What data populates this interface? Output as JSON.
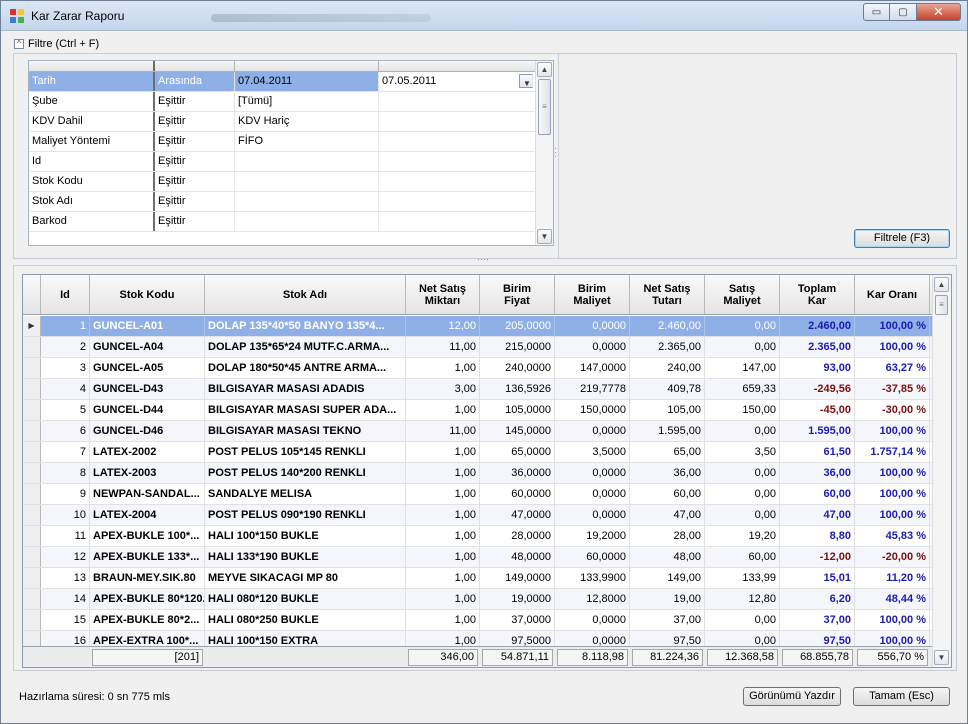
{
  "window": {
    "title": "Kar Zarar Raporu",
    "controls": {
      "minimize": "▭",
      "maximize": "▢",
      "close": "✕"
    }
  },
  "filter": {
    "header_label": "Filtre (Ctrl + F)",
    "rows": [
      {
        "name": "Tarih",
        "operator": "Arasında",
        "value1": "07.04.2011",
        "value2": "07.05.2011",
        "selected": true
      },
      {
        "name": "Şube",
        "operator": "Eşittir",
        "value1": "[Tümü]",
        "value2": ""
      },
      {
        "name": "KDV Dahil",
        "operator": "Eşittir",
        "value1": "KDV Hariç",
        "value2": ""
      },
      {
        "name": "Maliyet Yöntemi",
        "operator": "Eşittir",
        "value1": "FİFO",
        "value2": ""
      },
      {
        "name": "Id",
        "operator": "Eşittir",
        "value1": "",
        "value2": ""
      },
      {
        "name": "Stok Kodu",
        "operator": "Eşittir",
        "value1": "",
        "value2": ""
      },
      {
        "name": "Stok Adı",
        "operator": "Eşittir",
        "value1": "",
        "value2": ""
      },
      {
        "name": "Barkod",
        "operator": "Eşittir",
        "value1": "",
        "value2": ""
      }
    ],
    "apply_button": "Filtrele (F3)"
  },
  "grid": {
    "columns": [
      {
        "key": "id",
        "label": "Id"
      },
      {
        "key": "kod",
        "label": "Stok Kodu"
      },
      {
        "key": "ad",
        "label": "Stok Adı"
      },
      {
        "key": "mik",
        "label": "Net Satış\nMiktarı"
      },
      {
        "key": "fiy",
        "label": "Birim\nFiyat"
      },
      {
        "key": "mal",
        "label": "Birim\nMaliyet"
      },
      {
        "key": "tut",
        "label": "Net Satış\nTutarı"
      },
      {
        "key": "sm",
        "label": "Satış\nMaliyet"
      },
      {
        "key": "kar",
        "label": "Toplam\nKar"
      },
      {
        "key": "oran",
        "label": "Kar Oranı"
      }
    ],
    "rows": [
      {
        "id": "1",
        "kod": "GUNCEL-A01",
        "ad": "DOLAP 135*40*50 BANYO 135*4...",
        "mik": "12,00",
        "fiy": "205,0000",
        "mal": "0,0000",
        "tut": "2.460,00",
        "sm": "0,00",
        "kar": "2.460,00",
        "oran": "100,00 %",
        "neg": false,
        "selected": true
      },
      {
        "id": "2",
        "kod": "GUNCEL-A04",
        "ad": "DOLAP 135*65*24 MUTF.C.ARMA...",
        "mik": "11,00",
        "fiy": "215,0000",
        "mal": "0,0000",
        "tut": "2.365,00",
        "sm": "0,00",
        "kar": "2.365,00",
        "oran": "100,00 %",
        "neg": false
      },
      {
        "id": "3",
        "kod": "GUNCEL-A05",
        "ad": "DOLAP 180*50*45 ANTRE ARMA...",
        "mik": "1,00",
        "fiy": "240,0000",
        "mal": "147,0000",
        "tut": "240,00",
        "sm": "147,00",
        "kar": "93,00",
        "oran": "63,27 %",
        "neg": false
      },
      {
        "id": "4",
        "kod": "GUNCEL-D43",
        "ad": "BILGISAYAR MASASI ADADIS",
        "mik": "3,00",
        "fiy": "136,5926",
        "mal": "219,7778",
        "tut": "409,78",
        "sm": "659,33",
        "kar": "-249,56",
        "oran": "-37,85 %",
        "neg": true
      },
      {
        "id": "5",
        "kod": "GUNCEL-D44",
        "ad": "BILGISAYAR MASASI SUPER ADA...",
        "mik": "1,00",
        "fiy": "105,0000",
        "mal": "150,0000",
        "tut": "105,00",
        "sm": "150,00",
        "kar": "-45,00",
        "oran": "-30,00 %",
        "neg": true
      },
      {
        "id": "6",
        "kod": "GUNCEL-D46",
        "ad": "BILGISAYAR MASASI TEKNO",
        "mik": "11,00",
        "fiy": "145,0000",
        "mal": "0,0000",
        "tut": "1.595,00",
        "sm": "0,00",
        "kar": "1.595,00",
        "oran": "100,00 %",
        "neg": false
      },
      {
        "id": "7",
        "kod": "LATEX-2002",
        "ad": "POST PELUS 105*145 RENKLI",
        "mik": "1,00",
        "fiy": "65,0000",
        "mal": "3,5000",
        "tut": "65,00",
        "sm": "3,50",
        "kar": "61,50",
        "oran": "1.757,14 %",
        "neg": false
      },
      {
        "id": "8",
        "kod": "LATEX-2003",
        "ad": "POST PELUS 140*200 RENKLI",
        "mik": "1,00",
        "fiy": "36,0000",
        "mal": "0,0000",
        "tut": "36,00",
        "sm": "0,00",
        "kar": "36,00",
        "oran": "100,00 %",
        "neg": false
      },
      {
        "id": "9",
        "kod": "NEWPAN-SANDAL...",
        "ad": "SANDALYE MELISA",
        "mik": "1,00",
        "fiy": "60,0000",
        "mal": "0,0000",
        "tut": "60,00",
        "sm": "0,00",
        "kar": "60,00",
        "oran": "100,00 %",
        "neg": false
      },
      {
        "id": "10",
        "kod": "LATEX-2004",
        "ad": "POST PELUS 090*190 RENKLI",
        "mik": "1,00",
        "fiy": "47,0000",
        "mal": "0,0000",
        "tut": "47,00",
        "sm": "0,00",
        "kar": "47,00",
        "oran": "100,00 %",
        "neg": false
      },
      {
        "id": "11",
        "kod": "APEX-BUKLE 100*...",
        "ad": "HALI 100*150 BUKLE",
        "mik": "1,00",
        "fiy": "28,0000",
        "mal": "19,2000",
        "tut": "28,00",
        "sm": "19,20",
        "kar": "8,80",
        "oran": "45,83 %",
        "neg": false
      },
      {
        "id": "12",
        "kod": "APEX-BUKLE 133*...",
        "ad": "HALI 133*190 BUKLE",
        "mik": "1,00",
        "fiy": "48,0000",
        "mal": "60,0000",
        "tut": "48,00",
        "sm": "60,00",
        "kar": "-12,00",
        "oran": "-20,00 %",
        "neg": true
      },
      {
        "id": "13",
        "kod": "BRAUN-MEY.SIK.80",
        "ad": "MEYVE SIKACAGI MP 80",
        "mik": "1,00",
        "fiy": "149,0000",
        "mal": "133,9900",
        "tut": "149,00",
        "sm": "133,99",
        "kar": "15,01",
        "oran": "11,20 %",
        "neg": false
      },
      {
        "id": "14",
        "kod": "APEX-BUKLE 80*120...",
        "ad": "HALI 080*120 BUKLE",
        "mik": "1,00",
        "fiy": "19,0000",
        "mal": "12,8000",
        "tut": "19,00",
        "sm": "12,80",
        "kar": "6,20",
        "oran": "48,44 %",
        "neg": false
      },
      {
        "id": "15",
        "kod": "APEX-BUKLE 80*2...",
        "ad": "HALI 080*250 BUKLE",
        "mik": "1,00",
        "fiy": "37,0000",
        "mal": "0,0000",
        "tut": "37,00",
        "sm": "0,00",
        "kar": "37,00",
        "oran": "100,00 %",
        "neg": false
      },
      {
        "id": "16",
        "kod": "APEX-EXTRA 100*...",
        "ad": "HALI 100*150 EXTRA",
        "mik": "1,00",
        "fiy": "97,5000",
        "mal": "0,0000",
        "tut": "97,50",
        "sm": "0,00",
        "kar": "97,50",
        "oran": "100,00 %",
        "neg": false
      }
    ],
    "footer": {
      "count": "[201]",
      "mik": "346,00",
      "fiy": "54.871,11",
      "mal": "8.118,98",
      "tut": "81.224,36",
      "sm": "12.368,58",
      "kar": "68.855,78",
      "oran": "556,70 %"
    }
  },
  "status": {
    "prep_time": "Hazırlama süresi: 0 sn 775 mls"
  },
  "buttons": {
    "print_view": "Görünümü Yazdır",
    "ok": "Tamam (Esc)"
  },
  "colors": {
    "selection": "#8fb0e6",
    "positive": "#1b1bb3",
    "negative": "#7a1010"
  }
}
